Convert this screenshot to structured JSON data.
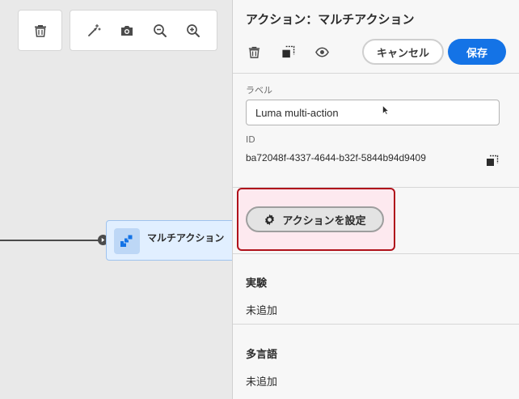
{
  "panel": {
    "title": "アクション：マルチアクション",
    "cancel_label": "キャンセル",
    "save_label": "保存"
  },
  "label_field": {
    "label": "ラベル",
    "value": "Luma multi-action"
  },
  "id_field": {
    "label": "ID",
    "value": "ba72048f-4337-4644-b32f-5844b94d9409"
  },
  "configure_button_label": "アクションを設定",
  "experiment": {
    "title": "実験",
    "value": "未追加"
  },
  "multilingual": {
    "title": "多言語",
    "value": "未追加"
  },
  "canvas": {
    "node_label": "マルチアクション"
  },
  "colors": {
    "primary": "#1473e6",
    "highlight_border": "#b0121b",
    "node_bg": "#e1efff"
  }
}
